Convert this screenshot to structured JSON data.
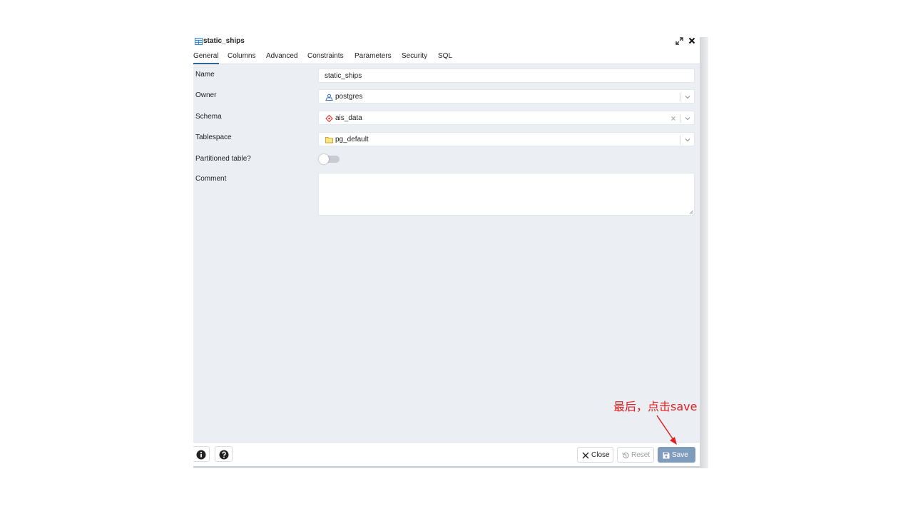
{
  "dialog": {
    "title": "static_ships"
  },
  "tabs": [
    {
      "label": "General",
      "active": true
    },
    {
      "label": "Columns"
    },
    {
      "label": "Advanced"
    },
    {
      "label": "Constraints"
    },
    {
      "label": "Parameters"
    },
    {
      "label": "Security"
    },
    {
      "label": "SQL"
    }
  ],
  "form": {
    "name_label": "Name",
    "name_value": "static_ships",
    "owner_label": "Owner",
    "owner_value": "postgres",
    "schema_label": "Schema",
    "schema_value": "ais_data",
    "tablespace_label": "Tablespace",
    "tablespace_value": "pg_default",
    "partitioned_label": "Partitioned table?",
    "partitioned_value": false,
    "comment_label": "Comment",
    "comment_value": ""
  },
  "footer": {
    "info_icon": "info-icon",
    "help_icon": "help-icon",
    "close_label": "Close",
    "reset_label": "Reset",
    "save_label": "Save"
  },
  "annotation": {
    "text": "最后，点击save",
    "color": "#e02020"
  },
  "colors": {
    "accent": "#326690",
    "save_button": "#7f9cbd",
    "panel_bg": "#ebeef3"
  }
}
